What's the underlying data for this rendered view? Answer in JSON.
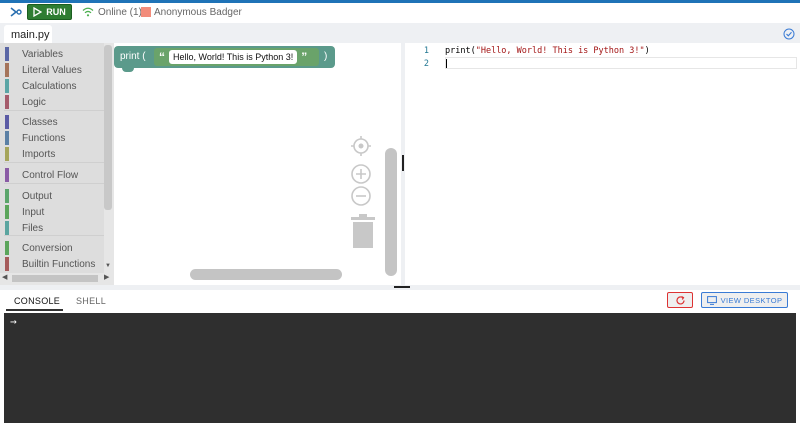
{
  "toolbar": {
    "run_label": "RUN",
    "status": "Online (1)",
    "user_name": "Anonymous Badger",
    "avatar_color": "#f28c7b",
    "run_color": "#2e7d32"
  },
  "tabs": {
    "file": "main.py"
  },
  "blocks": {
    "categories": [
      {
        "label": "Variables",
        "color": "#5b67a5"
      },
      {
        "label": "Literal Values",
        "color": "#a5745b"
      },
      {
        "label": "Calculations",
        "color": "#5ba5a5"
      },
      {
        "label": "Logic",
        "color": "#a55b6b"
      },
      {
        "label": "Classes",
        "color": "#5b5ba5"
      },
      {
        "label": "Functions",
        "color": "#5b80a5"
      },
      {
        "label": "Imports",
        "color": "#a5a55b"
      },
      {
        "label": "Control Flow",
        "color": "#8a5ba5"
      },
      {
        "label": "Output",
        "color": "#5ba56b"
      },
      {
        "label": "Input",
        "color": "#5ba55b"
      },
      {
        "label": "Files",
        "color": "#5ba5a0"
      },
      {
        "label": "Conversion",
        "color": "#5ba55b"
      },
      {
        "label": "Builtin Functions",
        "color": "#a55b5b"
      }
    ]
  },
  "workspace": {
    "print_label": "print (",
    "string_value": "Hello, World! This is Python 3!",
    "open_quote": "“",
    "close_quote": "”",
    "close_paren": ")"
  },
  "editor": {
    "lines": [
      {
        "number": "1",
        "code_fn": "print(",
        "code_str": "\"Hello, World! This is Python 3!\"",
        "code_end": ")"
      },
      {
        "number": "2",
        "code_fn": "",
        "code_str": "",
        "code_end": ""
      }
    ]
  },
  "console": {
    "tab_console": "CONSOLE",
    "tab_shell": "SHELL",
    "view_desktop_label": "VIEW DESKTOP",
    "prompt": "→"
  }
}
